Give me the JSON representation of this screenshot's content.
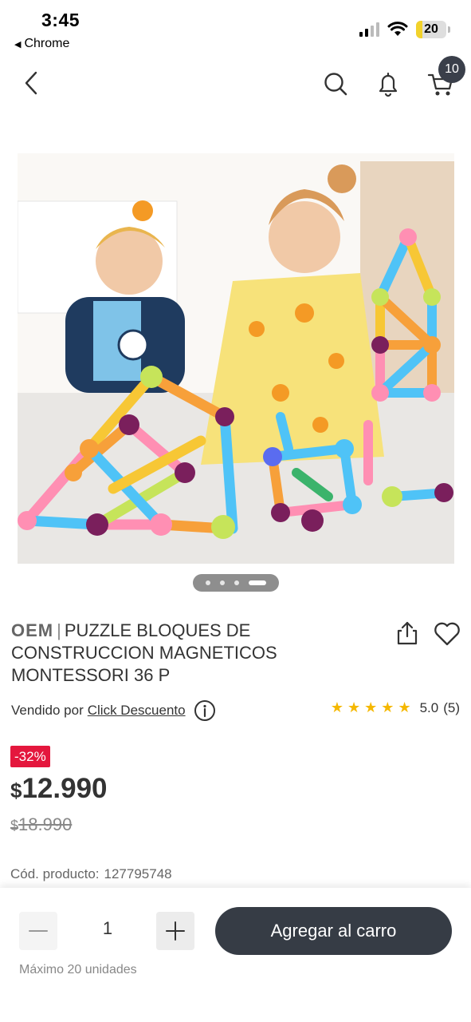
{
  "status_bar": {
    "time": "3:45",
    "back_app": "Chrome",
    "battery_level": "20"
  },
  "nav": {
    "cart_count": "10"
  },
  "gallery": {
    "total_images": 4,
    "active_index": 3
  },
  "product": {
    "brand": "OEM",
    "separator": "|",
    "title": "PUZZLE BLOQUES DE CONSTRUCCION MAGNETICOS MONTESSORI 36 P",
    "seller_prefix": "Vendido por",
    "seller_name": "Click Descuento",
    "rating_value": "5.0",
    "rating_count": "(5)",
    "stars": "★★★★★",
    "discount": "-32%",
    "currency": "$",
    "price": "12.990",
    "old_price": "18.990",
    "sku_label": "Cód. producto:",
    "sku_value": "127795748"
  },
  "cart_bar": {
    "quantity": "1",
    "add_label": "Agregar al carro",
    "max_note": "Máximo 20 unidades"
  },
  "colors": {
    "brand_dark": "#363c45",
    "discount_red": "#e4173d",
    "star_yellow": "#f5b800"
  }
}
